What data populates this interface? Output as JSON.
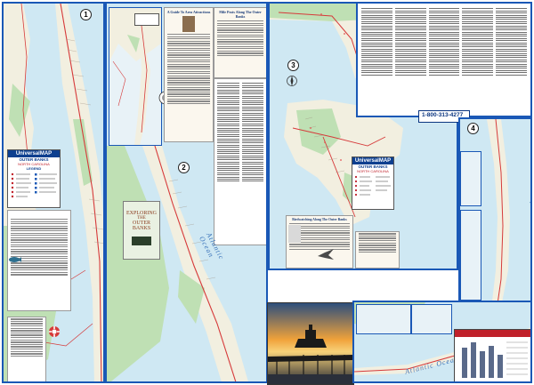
{
  "map": {
    "panel_numbers": [
      "1",
      "2",
      "3",
      "4"
    ],
    "brand": "UniversalMAP",
    "title": "OUTER BANKS",
    "subtitle": "NORTH CAROLINA",
    "legend_label": "LEGEND",
    "cover_title_line1": "EXPLORING",
    "cover_title_line2": "THE",
    "cover_title_line3": "OUTER",
    "cover_title_line4": "BANKS",
    "ocean_label": "Atlantic Ocean",
    "phone": "1-800-313-4277",
    "inset_title": "A Guide To Area Attractions",
    "mile_posts_title": "Mile Posts Along The Outer Banks",
    "bird_title": "Birdwatching Along The Outer Banks",
    "colors": {
      "border": "#1a58b6",
      "water": "#cfe8f3",
      "land": "#f2efe0",
      "marsh": "#bfe0b4",
      "road": "#d63a3a"
    }
  }
}
